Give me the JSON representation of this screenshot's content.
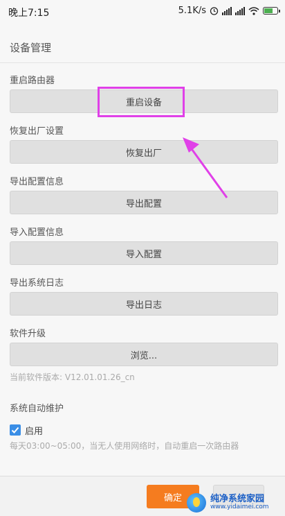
{
  "status_bar": {
    "time": "晚上7:15",
    "speed": "5.1K/s"
  },
  "header": {
    "title": "设备管理"
  },
  "sections": [
    {
      "label": "重启路由器",
      "button": "重启设备"
    },
    {
      "label": "恢复出厂设置",
      "button": "恢复出厂"
    },
    {
      "label": "导出配置信息",
      "button": "导出配置"
    },
    {
      "label": "导入配置信息",
      "button": "导入配置"
    },
    {
      "label": "导出系统日志",
      "button": "导出日志"
    },
    {
      "label": "软件升级",
      "button": "浏览..."
    }
  ],
  "firmware_version": "当前软件版本: V12.01.01.26_cn",
  "auto_maintenance": {
    "label": "系统自动维护",
    "checkbox_label": "启用",
    "checked": true,
    "description": "每天03:00~05:00，当无人使用网络时，自动重启一次路由器"
  },
  "footer": {
    "ok_label": "确定"
  },
  "watermark": {
    "title": "纯净系统家园",
    "url": "www.yidaimei.com"
  },
  "colors": {
    "highlight": "#e040e8",
    "arrow": "#e040e8",
    "ok_button": "#f57c1f",
    "checkbox": "#3a8ee6"
  }
}
